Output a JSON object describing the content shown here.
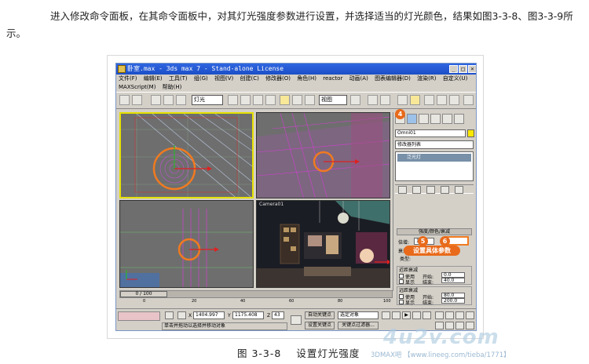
{
  "paragraph": "进入修改命令面板，在其命令面板中，对其灯光强度参数进行设置，并选择适当的灯光颜色，结果如图3-3-8、图3-3-9所示。",
  "app": {
    "title": "卧室.max - 3ds max 7  - Stand-alone License",
    "menus": [
      "文件(F)",
      "编辑(E)",
      "工具(T)",
      "组(G)",
      "视图(V)",
      "创建(C)",
      "修改器(O)",
      "角色(H)",
      "reactor",
      "动画(A)",
      "图表编辑器(D)",
      "渲染(R)",
      "自定义(U)",
      "MAXScript(M)",
      "帮助(H)"
    ],
    "toolbar": {
      "selection_filter": "灯光",
      "ref_coord": "视图"
    },
    "viewports": {
      "camera_label": "Camera01"
    },
    "command_panel": {
      "object_name": "Omni01",
      "modifier_list": "修改器列表",
      "stack_item": "泛光灯",
      "rollout_title": "强度/颜色/衰减",
      "multiplier_label": "倍增:",
      "multiplier_value": "1.0",
      "decay_group": "衰退",
      "decay_type_label": "类型:",
      "near_atten": "近距衰减",
      "far_atten": "远距衰减",
      "use_label": "使用",
      "show_label": "显示",
      "start_label": "开始:",
      "end_label": "结束:",
      "near_start": "0.0",
      "near_end": "40.0",
      "far_start": "80.0",
      "far_end": "200.0"
    },
    "annotations": {
      "step4": "4",
      "step5": "5",
      "step6": "6",
      "callout": "设置具体参数"
    },
    "timeline": {
      "frame": "0 / 100",
      "ruler": [
        "0",
        "20",
        "40",
        "60",
        "80",
        "100"
      ]
    },
    "status": {
      "prompt": "单击并拖动以选择并移动对象",
      "x": "1404.997",
      "y": "1175.408",
      "z": "43",
      "auto_key": "自动关键点",
      "set_key": "设置关键点",
      "selected": "选定对象",
      "key_filters": "关键点过滤器..."
    }
  },
  "caption": {
    "num": "图 3-3-8",
    "text": "设置灯光强度"
  },
  "watermark": {
    "logo": "4u2v.com",
    "line": "3DMAX吧 【www.lineeg.com/tieba/1771】"
  }
}
